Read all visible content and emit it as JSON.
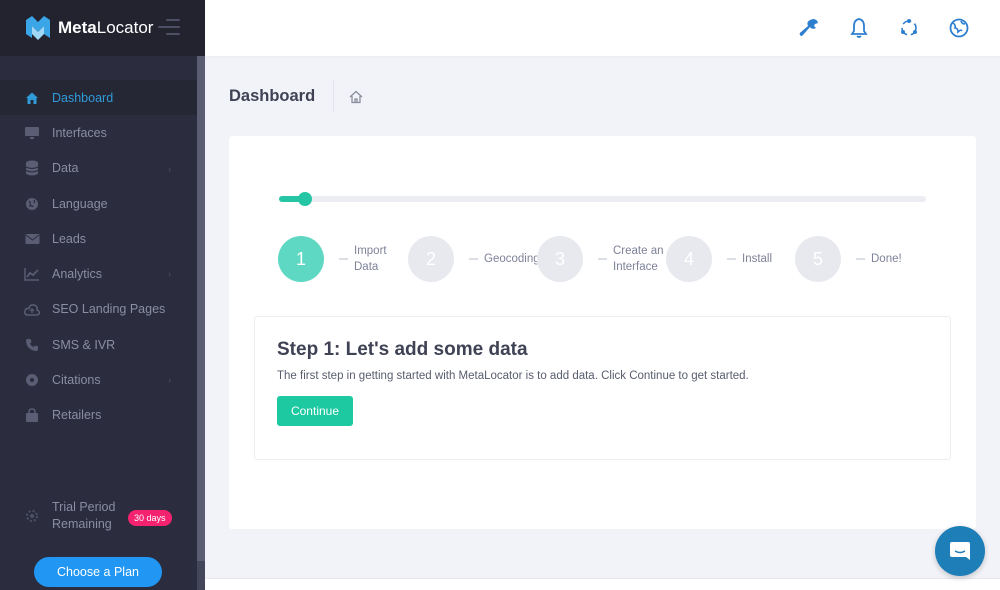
{
  "brand": {
    "name_bold": "Meta",
    "name_light": "Locator"
  },
  "colors": {
    "accent": "#2f9bd9",
    "success": "#26c6a5",
    "badge": "#f4226f",
    "sidebar": "#2b2c3d"
  },
  "sidebar": {
    "items": [
      {
        "label": "Dashboard",
        "icon": "home-icon",
        "active": true
      },
      {
        "label": "Interfaces",
        "icon": "monitor-icon"
      },
      {
        "label": "Data",
        "icon": "database-icon",
        "has_submenu": true
      },
      {
        "label": "Language",
        "icon": "globe-icon"
      },
      {
        "label": "Leads",
        "icon": "envelope-icon"
      },
      {
        "label": "Analytics",
        "icon": "chart-line-icon",
        "has_submenu": true
      },
      {
        "label": "SEO Landing Pages",
        "icon": "cloud-upload-icon"
      },
      {
        "label": "SMS & IVR",
        "icon": "phone-icon"
      },
      {
        "label": "Citations",
        "icon": "location-icon",
        "has_submenu": true
      },
      {
        "label": "Retailers",
        "icon": "shopping-bag-icon"
      }
    ],
    "trial_label": "Trial Period Remaining",
    "trial_badge": "30 days",
    "plan_button": "Choose a Plan"
  },
  "header": {
    "icons": [
      "wrench-icon",
      "bell-icon",
      "users-cycle-icon",
      "globe-icon"
    ]
  },
  "page": {
    "title": "Dashboard",
    "breadcrumb_icon": "home-icon"
  },
  "wizard": {
    "progress": 0.035,
    "steps": [
      {
        "number": "1",
        "label": "Import Data",
        "active": true
      },
      {
        "number": "2",
        "label": "Geocoding"
      },
      {
        "number": "3",
        "label": "Create an Interface"
      },
      {
        "number": "4",
        "label": "Install"
      },
      {
        "number": "5",
        "label": "Done!"
      }
    ],
    "heading": "Step 1: Let's add some data",
    "description": "The first step in getting started with MetaLocator is to add data. Click Continue to get started.",
    "continue_label": "Continue"
  },
  "chat": {
    "icon": "chat-bubble-icon"
  }
}
